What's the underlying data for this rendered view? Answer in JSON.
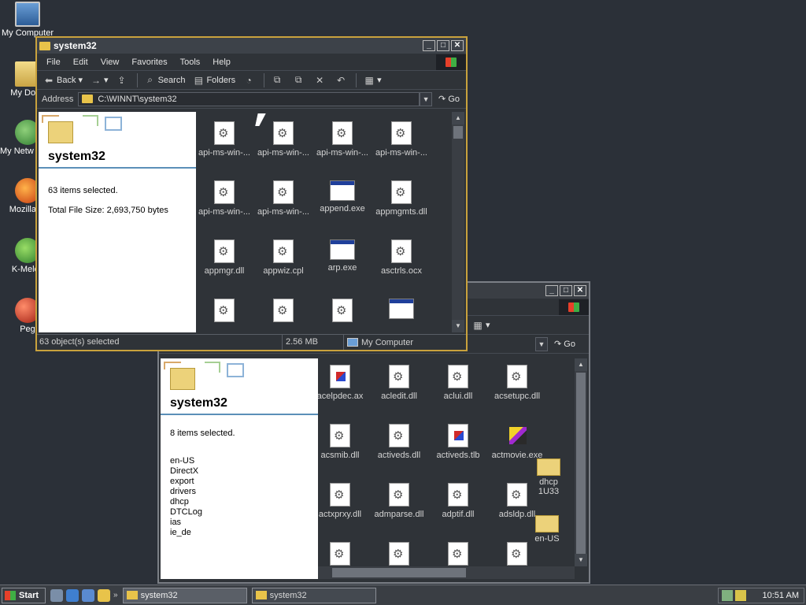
{
  "desktop": {
    "icons": [
      {
        "label": "My Computer",
        "icon": "computer-icon"
      },
      {
        "label": "My Docu",
        "icon": "documents-icon"
      },
      {
        "label": "My Netw Place",
        "icon": "network-icon"
      },
      {
        "label": "Mozilla Fi",
        "icon": "firefox-icon"
      },
      {
        "label": "K-Melec",
        "icon": "kmeleon-icon"
      },
      {
        "label": "Peg",
        "icon": "pegasus-icon"
      }
    ]
  },
  "front_window": {
    "title": "system32",
    "menu": [
      "File",
      "Edit",
      "View",
      "Favorites",
      "Tools",
      "Help"
    ],
    "toolbar": {
      "back": "Back",
      "search": "Search",
      "folders": "Folders"
    },
    "address": {
      "label": "Address",
      "value": "C:\\WINNT\\system32",
      "go": "Go"
    },
    "panel": {
      "title": "system32",
      "selected": "63 items selected.",
      "size": "Total File Size: 2,693,750 bytes"
    },
    "files": [
      {
        "name": "api-ms-win-...",
        "type": "gear"
      },
      {
        "name": "api-ms-win-...",
        "type": "gear"
      },
      {
        "name": "api-ms-win-...",
        "type": "gear"
      },
      {
        "name": "api-ms-win-...",
        "type": "gear"
      },
      {
        "name": "api-ms-win-...",
        "type": "gear"
      },
      {
        "name": "api-ms-win-...",
        "type": "gear"
      },
      {
        "name": "append.exe",
        "type": "exe"
      },
      {
        "name": "appmgmts.dll",
        "type": "gear"
      },
      {
        "name": "appmgr.dll",
        "type": "gear"
      },
      {
        "name": "appwiz.cpl",
        "type": "gear"
      },
      {
        "name": "arp.exe",
        "type": "exe"
      },
      {
        "name": "asctrls.ocx",
        "type": "gear"
      },
      {
        "name": "",
        "type": "gear"
      },
      {
        "name": "",
        "type": "gear"
      },
      {
        "name": "",
        "type": "gear"
      },
      {
        "name": "",
        "type": "exe"
      }
    ],
    "status": {
      "objects": "63 object(s) selected",
      "size": "2.56 MB",
      "zone": "My Computer"
    }
  },
  "back_window": {
    "address": {
      "go": "Go"
    },
    "panel": {
      "title": "system32",
      "selected": "8 items selected.",
      "folders": [
        "en-US",
        "DirectX",
        "export",
        "drivers",
        "dhcp",
        "DTCLog",
        "ias",
        "ie_de"
      ]
    },
    "files": [
      {
        "name": "acelpdec.ax",
        "type": "media"
      },
      {
        "name": "acledit.dll",
        "type": "gear"
      },
      {
        "name": "aclui.dll",
        "type": "gear"
      },
      {
        "name": "acsetupc.dll",
        "type": "gear"
      },
      {
        "name": "acsmib.dll",
        "type": "gear"
      },
      {
        "name": "activeds.dll",
        "type": "gear"
      },
      {
        "name": "activeds.tlb",
        "type": "media"
      },
      {
        "name": "actmovie.exe",
        "type": "movie"
      },
      {
        "name": "actxprxy.dll",
        "type": "gear"
      },
      {
        "name": "admparse.dll",
        "type": "gear"
      },
      {
        "name": "adptif.dll",
        "type": "gear"
      },
      {
        "name": "adsldp.dll",
        "type": "gear"
      },
      {
        "name": "",
        "type": "gear"
      },
      {
        "name": "",
        "type": "gear"
      },
      {
        "name": "",
        "type": "gear"
      },
      {
        "name": "",
        "type": "gear"
      }
    ],
    "drag_items": [
      {
        "label": "dhcp",
        "sub": "1U33"
      },
      {
        "label": "en-US",
        "sub": ""
      }
    ]
  },
  "taskbar": {
    "start": "Start",
    "tasks": [
      {
        "label": "system32",
        "active": true
      },
      {
        "label": "system32",
        "active": false
      }
    ],
    "more": "»",
    "clock": "10:51 AM"
  }
}
